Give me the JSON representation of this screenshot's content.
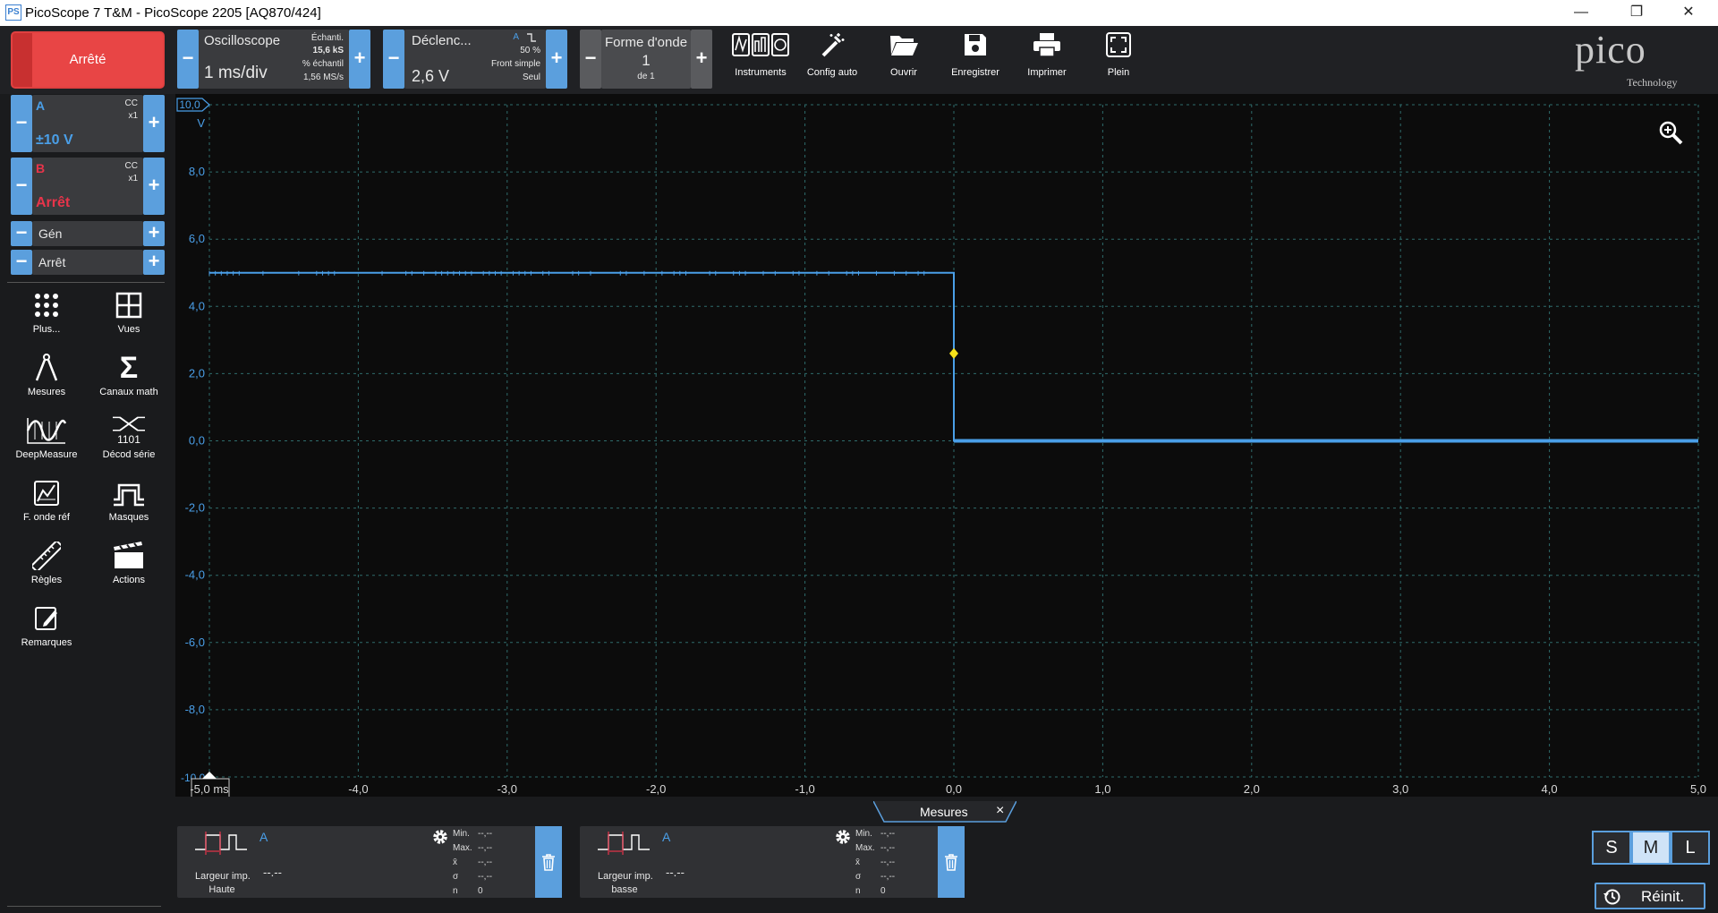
{
  "window": {
    "icon_text": "PS",
    "title": "PicoScope 7 T&M  - PicoScope 2205 [AQ870/424]",
    "minimize": "—",
    "restore": "❐",
    "close": "✕"
  },
  "toolbar": {
    "run_state": "Arrêté",
    "minus": "−",
    "plus": "+",
    "scope": {
      "title": "Oscilloscope",
      "timebase": "1 ms/div",
      "samples_label": "Échanti.",
      "samples_value": "15,6 kS",
      "rate_label": "% échantil",
      "rate_value": "1,56 MS/s"
    },
    "trigger": {
      "title": "Déclenc...",
      "level": "2,6 V",
      "channel": "A",
      "edge_icon": "falling-edge-icon",
      "percent": "50 %",
      "mode": "Front simple",
      "mode2": "Seul"
    },
    "waveform": {
      "title": "Forme d'onde",
      "number": "1",
      "of": "de 1"
    },
    "buttons": [
      {
        "label": "Instruments",
        "icon": "instruments-icon"
      },
      {
        "label": "Config auto",
        "icon": "auto-setup-icon"
      },
      {
        "label": "Ouvrir",
        "icon": "folder-open-icon"
      },
      {
        "label": "Enregistrer",
        "icon": "save-icon"
      },
      {
        "label": "Imprimer",
        "icon": "print-icon"
      },
      {
        "label": "Plein",
        "icon": "fullscreen-icon"
      }
    ],
    "logo": {
      "main": "pico",
      "sub": "Technology"
    }
  },
  "channels": {
    "a": {
      "name": "A",
      "coupling": "CC",
      "probe": "x1",
      "range": "±10 V",
      "color": "#4a9fe8"
    },
    "b": {
      "name": "B",
      "coupling": "CC",
      "probe": "x1",
      "range": "Arrêt",
      "color": "#e8344a"
    },
    "gen": {
      "label": "Gén",
      "state": "Arrêt"
    }
  },
  "sidebar_tools": [
    {
      "label": "Plus...",
      "icon": "more-dots-icon"
    },
    {
      "label": "Vues",
      "icon": "views-grid-icon"
    },
    {
      "label": "Mesures",
      "icon": "measurements-icon"
    },
    {
      "label": "Canaux math",
      "icon": "sigma-icon"
    },
    {
      "label": "DeepMeasure",
      "icon": "deepmeasure-icon"
    },
    {
      "label": "Décod série",
      "icon": "serial-decode-icon"
    },
    {
      "label": "F. onde réf",
      "icon": "reference-waveform-icon"
    },
    {
      "label": "Masques",
      "icon": "mask-icon"
    },
    {
      "label": "Règles",
      "icon": "ruler-icon"
    },
    {
      "label": "Actions",
      "icon": "clapperboard-icon"
    },
    {
      "label": "Remarques",
      "icon": "notes-icon"
    }
  ],
  "plot": {
    "y_axis_top_label": "10,0",
    "y_unit": "V",
    "y_tick_labels": [
      "8,0",
      "6,0",
      "4,0",
      "2,0",
      "0,0",
      "-2,0",
      "-4,0",
      "-6,0",
      "-8,0"
    ],
    "y_bottom_label": "-10,0",
    "x_tick_labels": [
      "-5,0 ms",
      "-4,0",
      "-3,0",
      "-2,0",
      "-1,0",
      "0,0",
      "1,0",
      "2,0",
      "3,0",
      "4,0",
      "5,0"
    ],
    "zoom_icon": "zoom-in-icon",
    "trace_color": "#4a9fe8",
    "trigger_marker_color": "#f5e11a"
  },
  "chart_data": {
    "type": "line",
    "xlabel": "ms",
    "ylabel": "V",
    "xlim": [
      -5,
      5
    ],
    "ylim": [
      -10,
      10
    ],
    "grid": true,
    "series": [
      {
        "name": "A",
        "x": [
          -5,
          0,
          0,
          5
        ],
        "y": [
          5,
          5,
          0,
          0
        ]
      }
    ],
    "trigger_point": {
      "x": 0,
      "y": 2.6
    }
  },
  "measurements": {
    "tab_label": "Mesures",
    "tab_close": "×",
    "items": [
      {
        "channel": "A",
        "name_line1": "Largeur imp.",
        "name_line2": "Haute",
        "value": "--.--",
        "min_label": "Min.",
        "min": "--,--",
        "max_label": "Max.",
        "max": "--,--",
        "mean_label": "x̄",
        "mean": "--,--",
        "sd_label": "σ",
        "sd": "--,--",
        "n_label": "n",
        "n": "0"
      },
      {
        "channel": "A",
        "name_line1": "Largeur imp.",
        "name_line2": "basse",
        "value": "--.--",
        "min_label": "Min.",
        "min": "--,--",
        "max_label": "Max.",
        "max": "--,--",
        "mean_label": "x̄",
        "mean": "--,--",
        "sd_label": "σ",
        "sd": "--,--",
        "n_label": "n",
        "n": "0"
      }
    ]
  },
  "size_buttons": [
    "S",
    "M",
    "L"
  ],
  "size_active": "M",
  "reset_label": "Réinit."
}
